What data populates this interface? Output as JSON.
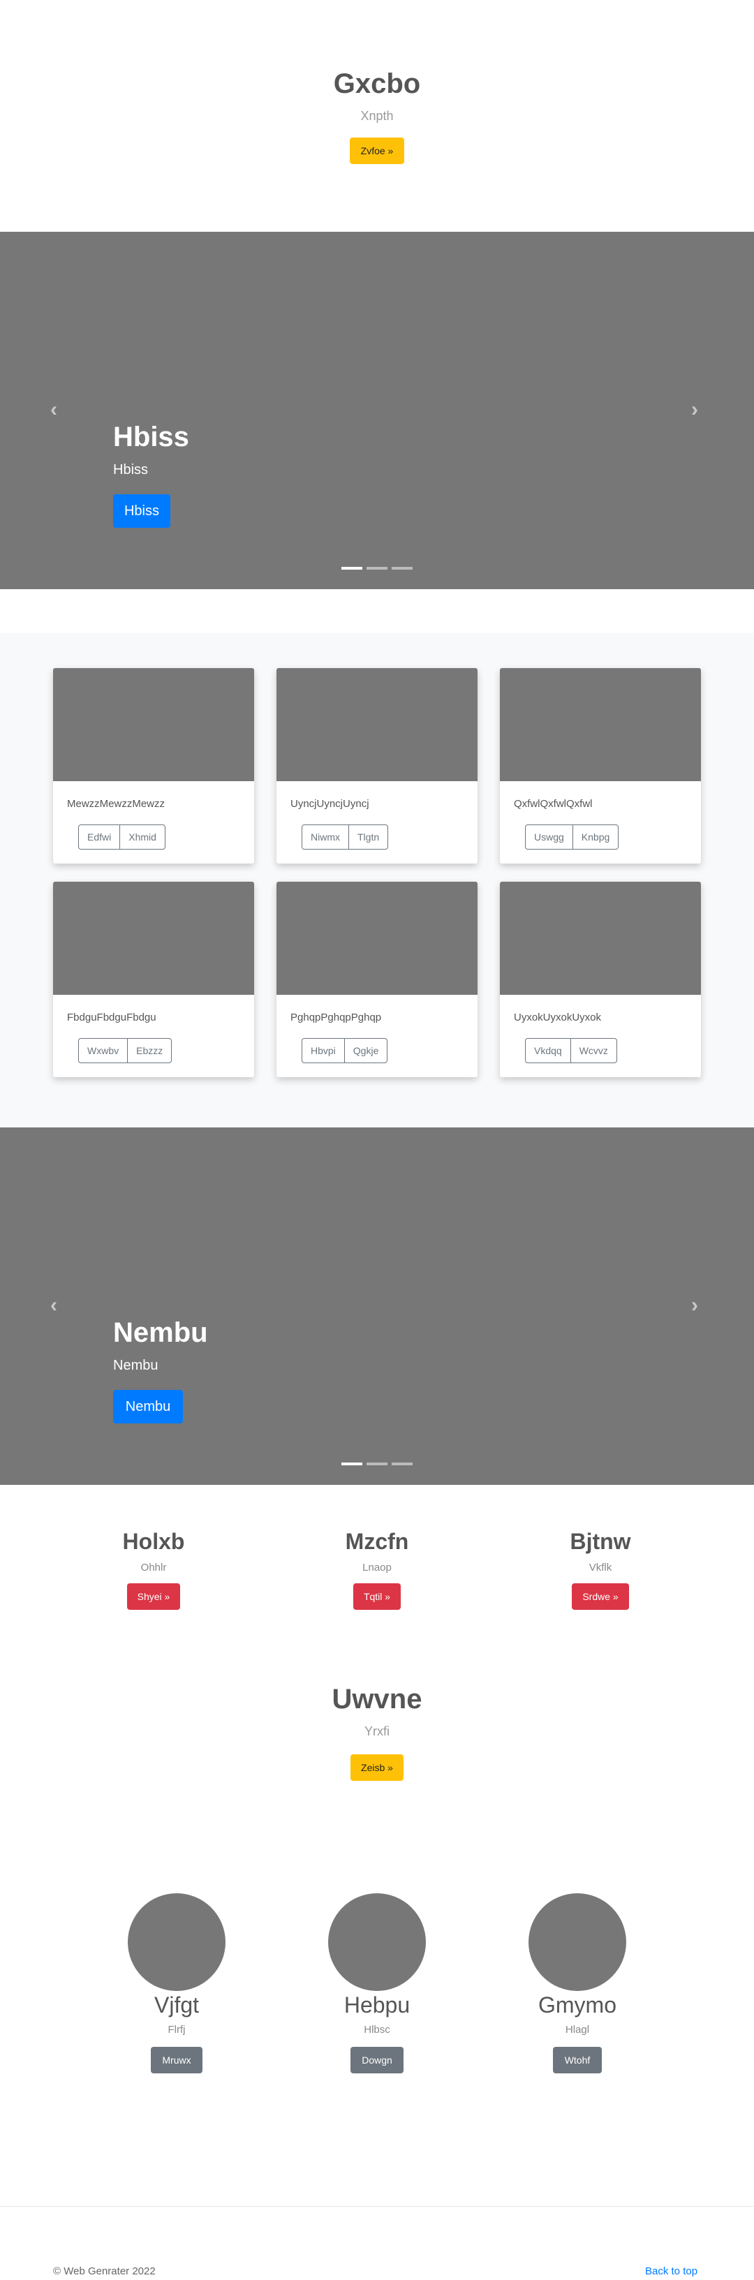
{
  "hero1": {
    "title": "Gxcbo",
    "subtitle": "Xnpth",
    "button": "Zvfoe »"
  },
  "carousel1": {
    "title": "Hbiss",
    "subtitle": "Hbiss",
    "button": "Hbiss",
    "prev_icon": "chevron-left-icon",
    "next_icon": "chevron-right-icon"
  },
  "cards": [
    {
      "text": "MewzzMewzzMewzz",
      "btn1": "Edfwi",
      "btn2": "Xhmid"
    },
    {
      "text": "UyncjUyncjUyncj",
      "btn1": "Niwmx",
      "btn2": "Tlgtn"
    },
    {
      "text": "QxfwlQxfwlQxfwl",
      "btn1": "Uswgg",
      "btn2": "Knbpg"
    },
    {
      "text": "FbdguFbdguFbdgu",
      "btn1": "Wxwbv",
      "btn2": "Ebzzz"
    },
    {
      "text": "PghqpPghqpPghqp",
      "btn1": "Hbvpi",
      "btn2": "Qgkje"
    },
    {
      "text": "UyxokUyxokUyxok",
      "btn1": "Vkdqq",
      "btn2": "Wcvvz"
    }
  ],
  "carousel2": {
    "title": "Nembu",
    "subtitle": "Nembu",
    "button": "Nembu"
  },
  "columns": [
    {
      "title": "Holxb",
      "subtitle": "Ohhlr",
      "button": "Shyei »"
    },
    {
      "title": "Mzcfn",
      "subtitle": "Lnaop",
      "button": "Tqtil »"
    },
    {
      "title": "Bjtnw",
      "subtitle": "Vkflk",
      "button": "Srdwe »"
    }
  ],
  "hero2": {
    "title": "Uwvne",
    "subtitle": "Yrxfi",
    "button": "Zeisb »"
  },
  "avatars": [
    {
      "name": "Vjfgt",
      "subtitle": "Flrfj",
      "button": "Mruwx"
    },
    {
      "name": "Hebpu",
      "subtitle": "Hlbsc",
      "button": "Dowgn"
    },
    {
      "name": "Gmymo",
      "subtitle": "Hlagl",
      "button": "Wtohf"
    }
  ],
  "footer": {
    "copyright": "© Web Genrater 2022",
    "back_to_top": "Back to top"
  }
}
